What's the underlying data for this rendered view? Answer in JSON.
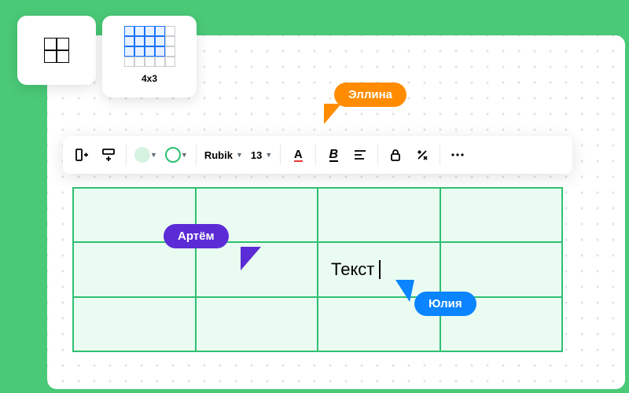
{
  "gridPicker": {
    "label": "4x3",
    "cols": 4,
    "rows": 3
  },
  "users": {
    "orange": "Эллина",
    "purple": "Артём",
    "blue": "Юлия"
  },
  "toolbar": {
    "fontName": "Rubik",
    "fontSize": "13",
    "textColorGlyph": "A",
    "boldGlyph": "B"
  },
  "cell": {
    "editingText": "Текст"
  },
  "colors": {
    "green": "#2fbf71",
    "orange": "#ff8c00",
    "purple": "#5b2bd6",
    "blue": "#0a84ff"
  }
}
